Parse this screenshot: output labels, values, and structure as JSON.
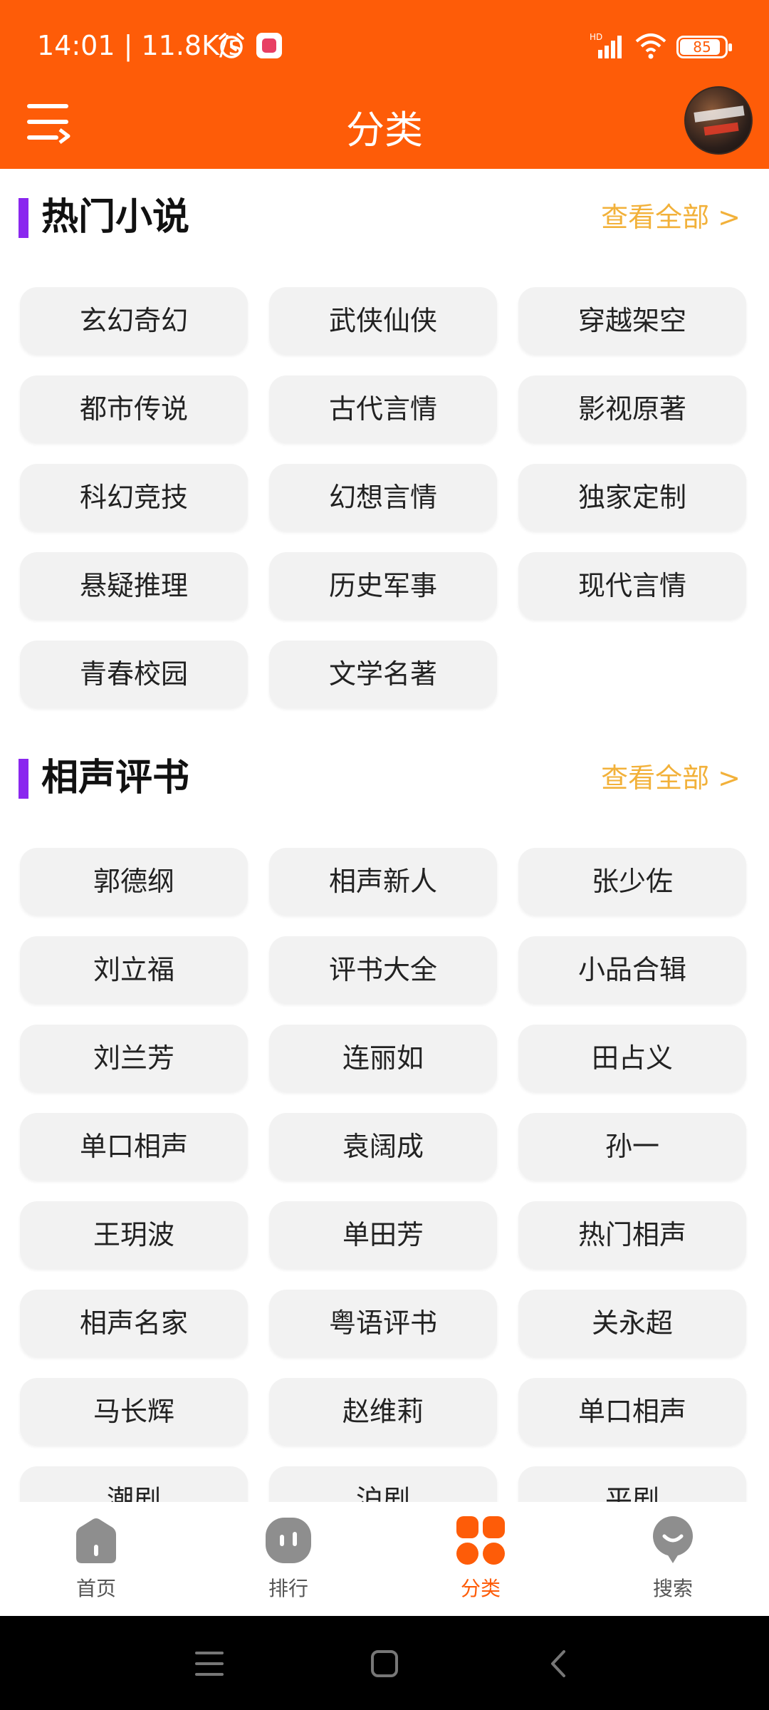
{
  "status_bar": {
    "time": "14:01 | 11.8K/s",
    "network": "HD",
    "battery": "85"
  },
  "header": {
    "title": "分类"
  },
  "sections": [
    {
      "title": "热门小说",
      "view_all": "查看全部 >",
      "items": [
        "玄幻奇幻",
        "武侠仙侠",
        "穿越架空",
        "都市传说",
        "古代言情",
        "影视原著",
        "科幻竞技",
        "幻想言情",
        "独家定制",
        "悬疑推理",
        "历史军事",
        "现代言情",
        "青春校园",
        "文学名著"
      ]
    },
    {
      "title": "相声评书",
      "view_all": "查看全部 >",
      "items": [
        "郭德纲",
        "相声新人",
        "张少佐",
        "刘立福",
        "评书大全",
        "小品合辑",
        "刘兰芳",
        "连丽如",
        "田占义",
        "单口相声",
        "袁阔成",
        "孙一",
        "王玥波",
        "单田芳",
        "热门相声",
        "相声名家",
        "粤语评书",
        "关永超",
        "马长辉",
        "赵维莉",
        "单口相声",
        "潮剧",
        "沪剧",
        "平剧"
      ]
    }
  ],
  "tabbar": {
    "items": [
      {
        "label": "首页",
        "icon": "home-icon"
      },
      {
        "label": "排行",
        "icon": "ranking-icon"
      },
      {
        "label": "分类",
        "icon": "category-icon",
        "active": true
      },
      {
        "label": "搜索",
        "icon": "search-icon"
      }
    ]
  },
  "colors": {
    "brand": "#fe5c08",
    "accent": "#8a27ef",
    "link": "#f2b13a",
    "chip": "#f2f2f2"
  }
}
